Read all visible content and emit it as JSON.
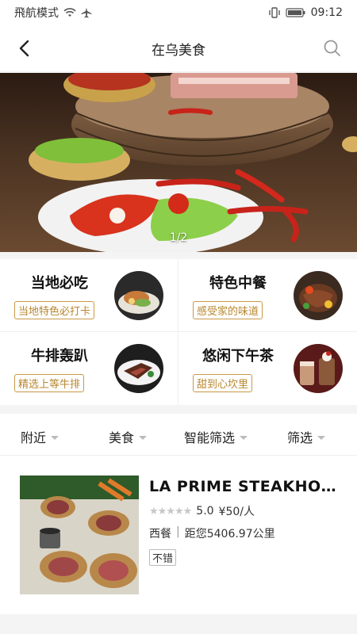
{
  "status_bar": {
    "carrier": "飛航模式",
    "time": "09:12"
  },
  "nav": {
    "title": "在乌美食"
  },
  "banner": {
    "indicator": "1/2"
  },
  "categories": [
    {
      "title": "当地必吃",
      "tag": "当地特色必打卡"
    },
    {
      "title": "特色中餐",
      "tag": "感受家的味道"
    },
    {
      "title": "牛排轰趴",
      "tag": "精选上等牛排"
    },
    {
      "title": "悠闲下午茶",
      "tag": "甜到心坎里"
    }
  ],
  "filters": [
    {
      "label": "附近"
    },
    {
      "label": "美食"
    },
    {
      "label": "智能筛选"
    },
    {
      "label": "筛选"
    }
  ],
  "restaurants": [
    {
      "name": "LA PRIME STEAKHOUS...",
      "stars": "★★★★★",
      "rating": "5.0",
      "price": "¥50/人",
      "cuisine": "西餐",
      "distance": "距您5406.97公里",
      "tag": "不错"
    }
  ],
  "colors": {
    "accent_gold": "#b8862e",
    "star_gray": "#c7c7c7"
  }
}
